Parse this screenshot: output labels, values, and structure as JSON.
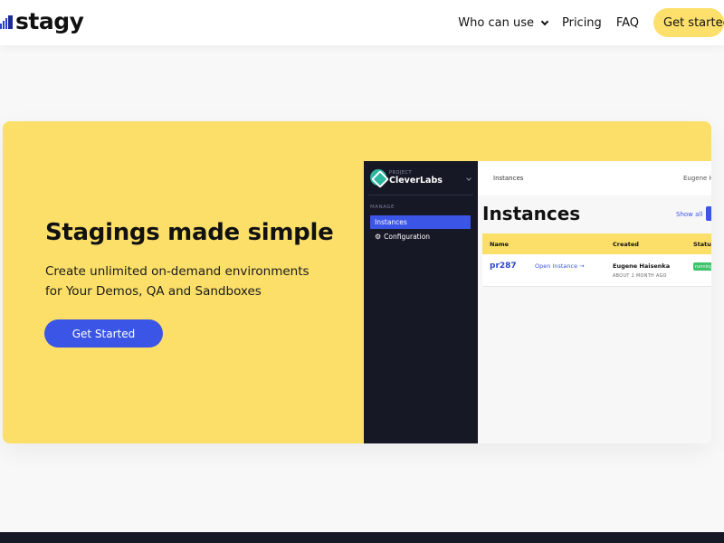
{
  "brand": {
    "name": "stagy",
    "accent": "#3b55e6",
    "yellow": "#fbdf68",
    "dark": "#161826"
  },
  "nav": {
    "who_can_use": "Who can use",
    "pricing": "Pricing",
    "faq": "FAQ",
    "cta": "Get started"
  },
  "hero": {
    "title": "Stagings made simple",
    "subtitle": "Create unlimited on-demand environments for Your Demos, QA and Sandboxes",
    "cta": "Get Started"
  },
  "app_preview": {
    "project_kicker": "PROJECT",
    "project_name": "CleverLabs",
    "section_label": "MANAGE",
    "menu": [
      {
        "label": "Instances",
        "active": true
      },
      {
        "label": "Configuration",
        "icon": "gear-icon",
        "active": false
      }
    ],
    "breadcrumb": "Instances",
    "user_name": "Eugene H",
    "page_title": "Instances",
    "show_all": "Show all",
    "table": {
      "columns": [
        "Name",
        "Created",
        "Status"
      ],
      "rows": [
        {
          "name": "pr287",
          "open_label": "Open Instance →",
          "created_by": "Eugene Haisenka",
          "created_ago": "ABOUT 1 MONTH AGO",
          "status": "running"
        }
      ]
    }
  }
}
